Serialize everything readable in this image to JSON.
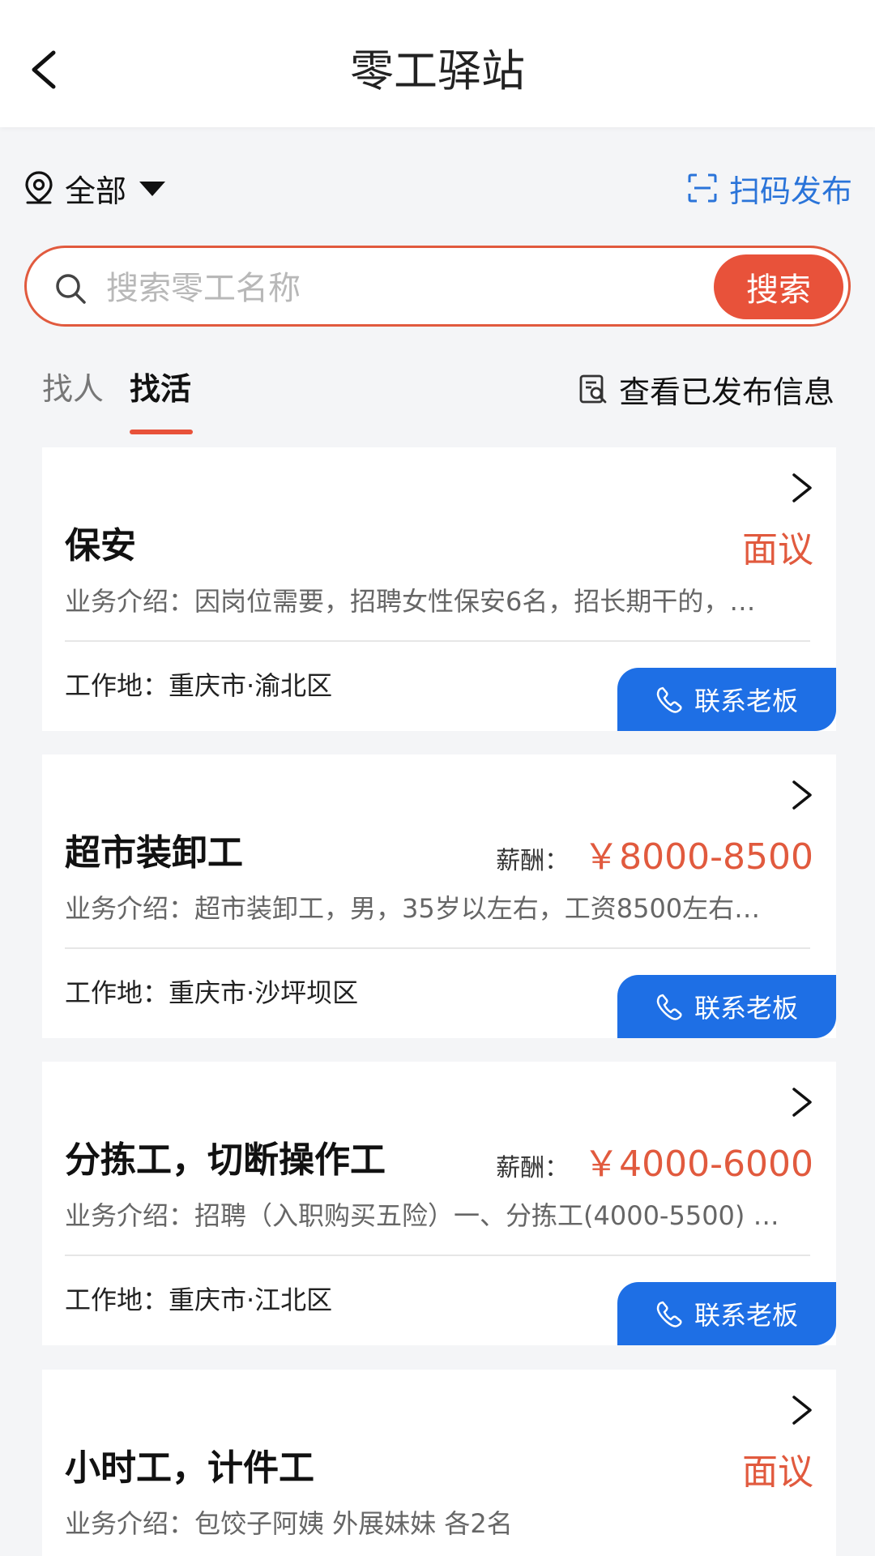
{
  "header": {
    "title": "零工驿站"
  },
  "filter": {
    "location": "全部",
    "scan_label": "扫码发布"
  },
  "search": {
    "placeholder": "搜索零工名称",
    "button": "搜索"
  },
  "tabs": [
    {
      "label": "找人"
    },
    {
      "label": "找活"
    }
  ],
  "view_posted": "查看已发布信息",
  "cards": [
    {
      "title": "保安",
      "salary_label": "",
      "salary": "面议",
      "desc": "业务介绍：因岗位需要，招聘女性保安6名，招长期干的，…",
      "workplace": "工作地：重庆市·渝北区",
      "contact": "联系老板"
    },
    {
      "title": "超市装卸工",
      "salary_label": "薪酬：",
      "salary": "￥8000-8500",
      "desc": "业务介绍：超市装卸工，男，35岁以左右，工资8500左右…",
      "workplace": "工作地：重庆市·沙坪坝区",
      "contact": "联系老板"
    },
    {
      "title": "分拣工，切断操作工",
      "salary_label": "薪酬：",
      "salary": "￥4000-6000",
      "desc": "业务介绍：招聘（入职购买五险）一、分拣工(4000-5500) …",
      "workplace": "工作地：重庆市·江北区",
      "contact": "联系老板"
    },
    {
      "title": "小时工，计件工",
      "salary_label": "",
      "salary": "面议",
      "desc": "业务介绍：包饺子阿姨 外展妹妹 各2名",
      "workplace": "",
      "contact": ""
    }
  ],
  "colors": {
    "accent": "#e8523a",
    "primary_blue": "#1e6fe5",
    "link_blue": "#2a74d9"
  },
  "icons": {
    "back": "chevron-left-icon",
    "location": "map-pin-icon",
    "dropdown": "caret-down-icon",
    "scan": "scan-icon",
    "search": "search-icon",
    "document": "document-search-icon",
    "card_arrow": "chevron-right-icon",
    "phone": "phone-icon"
  }
}
